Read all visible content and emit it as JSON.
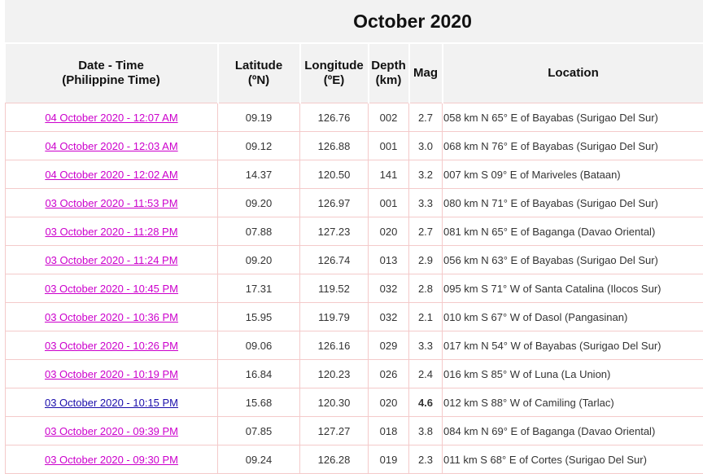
{
  "title": "October 2020",
  "colors": {
    "link": "#cc00cc",
    "link_alt": "#1a0dab",
    "header_bg": "#f2f2f2",
    "row_border": "#f4caca"
  },
  "headers": {
    "datetime_line1": "Date - Time",
    "datetime_line2": "(Philippine Time)",
    "lat_line1": "Latitude",
    "lat_line2": "(ºN)",
    "lon_line1": "Longitude",
    "lon_line2": "(ºE)",
    "depth_line1": "Depth",
    "depth_line2": "(km)",
    "mag": "Mag",
    "location": "Location"
  },
  "rows": [
    {
      "datetime": "04 October 2020 - 12:07 AM",
      "lat": "09.19",
      "lon": "126.76",
      "depth": "002",
      "mag": "2.7",
      "location": "058 km N 65° E of Bayabas (Surigao Del Sur)"
    },
    {
      "datetime": "04 October 2020 - 12:03 AM",
      "lat": "09.12",
      "lon": "126.88",
      "depth": "001",
      "mag": "3.0",
      "location": "068 km N 76° E of Bayabas (Surigao Del Sur)"
    },
    {
      "datetime": "04 October 2020 - 12:02 AM",
      "lat": "14.37",
      "lon": "120.50",
      "depth": "141",
      "mag": "3.2",
      "location": "007 km S 09° E of Mariveles (Bataan)"
    },
    {
      "datetime": "03 October 2020 - 11:53 PM",
      "lat": "09.20",
      "lon": "126.97",
      "depth": "001",
      "mag": "3.3",
      "location": "080 km N 71° E of Bayabas (Surigao Del Sur)"
    },
    {
      "datetime": "03 October 2020 - 11:28 PM",
      "lat": "07.88",
      "lon": "127.23",
      "depth": "020",
      "mag": "2.7",
      "location": "081 km N 65° E of Baganga (Davao Oriental)"
    },
    {
      "datetime": "03 October 2020 - 11:24 PM",
      "lat": "09.20",
      "lon": "126.74",
      "depth": "013",
      "mag": "2.9",
      "location": "056 km N 63° E of Bayabas (Surigao Del Sur)"
    },
    {
      "datetime": "03 October 2020 - 10:45 PM",
      "lat": "17.31",
      "lon": "119.52",
      "depth": "032",
      "mag": "2.8",
      "location": "095 km S 71° W of Santa Catalina (Ilocos Sur)"
    },
    {
      "datetime": "03 October 2020 - 10:36 PM",
      "lat": "15.95",
      "lon": "119.79",
      "depth": "032",
      "mag": "2.1",
      "location": "010 km S 67° W of Dasol (Pangasinan)"
    },
    {
      "datetime": "03 October 2020 - 10:26 PM",
      "lat": "09.06",
      "lon": "126.16",
      "depth": "029",
      "mag": "3.3",
      "location": "017 km N 54° W of Bayabas (Surigao Del Sur)"
    },
    {
      "datetime": "03 October 2020 - 10:19 PM",
      "lat": "16.84",
      "lon": "120.23",
      "depth": "026",
      "mag": "2.4",
      "location": "016 km S 85° W of Luna (La Union)"
    },
    {
      "datetime": "03 October 2020 - 10:15 PM",
      "lat": "15.68",
      "lon": "120.30",
      "depth": "020",
      "mag": "4.6",
      "location": "012 km S 88° W of Camiling (Tarlac)"
    },
    {
      "datetime": "03 October 2020 - 09:39 PM",
      "lat": "07.85",
      "lon": "127.27",
      "depth": "018",
      "mag": "3.8",
      "location": "084 km N 69° E of Baganga (Davao Oriental)"
    },
    {
      "datetime": "03 October 2020 - 09:30 PM",
      "lat": "09.24",
      "lon": "126.28",
      "depth": "019",
      "mag": "2.3",
      "location": "011 km S 68° E of Cortes (Surigao Del Sur)"
    }
  ]
}
